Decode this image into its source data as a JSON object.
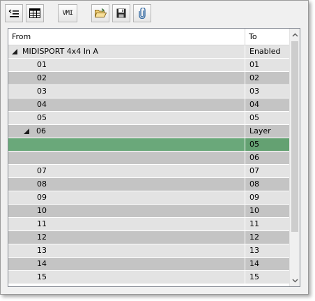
{
  "toolbar": {
    "buttons": [
      {
        "icon": "indent-list-icon"
      },
      {
        "icon": "grid-table-icon"
      },
      {
        "icon": "vmi-icon",
        "label": "VMI"
      },
      {
        "icon": "open-folder-icon"
      },
      {
        "icon": "save-floppy-icon"
      },
      {
        "icon": "paperclip-icon"
      }
    ]
  },
  "table": {
    "columns": {
      "from": "From",
      "to": "To"
    },
    "rows": [
      {
        "from": "MIDISPORT 4x4 In A",
        "to": "Enabled",
        "level": 0,
        "expanded": true,
        "shade": "light"
      },
      {
        "from": "01",
        "to": "01",
        "level": 2,
        "shade": "light"
      },
      {
        "from": "02",
        "to": "02",
        "level": 2,
        "shade": "dark"
      },
      {
        "from": "03",
        "to": "03",
        "level": 2,
        "shade": "light"
      },
      {
        "from": "04",
        "to": "04",
        "level": 2,
        "shade": "dark"
      },
      {
        "from": "05",
        "to": "05",
        "level": 2,
        "shade": "light"
      },
      {
        "from": "06",
        "to": "Layer",
        "level": 1,
        "expanded": true,
        "shade": "dark"
      },
      {
        "from": "",
        "to": "05",
        "level": 2,
        "shade": "selected"
      },
      {
        "from": "",
        "to": "06",
        "level": 2,
        "shade": "dark"
      },
      {
        "from": "07",
        "to": "07",
        "level": 2,
        "shade": "light"
      },
      {
        "from": "08",
        "to": "08",
        "level": 2,
        "shade": "dark"
      },
      {
        "from": "09",
        "to": "09",
        "level": 2,
        "shade": "light"
      },
      {
        "from": "10",
        "to": "10",
        "level": 2,
        "shade": "dark"
      },
      {
        "from": "11",
        "to": "11",
        "level": 2,
        "shade": "light"
      },
      {
        "from": "12",
        "to": "12",
        "level": 2,
        "shade": "dark"
      },
      {
        "from": "13",
        "to": "13",
        "level": 2,
        "shade": "light"
      },
      {
        "from": "14",
        "to": "14",
        "level": 2,
        "shade": "dark"
      },
      {
        "from": "15",
        "to": "15",
        "level": 2,
        "shade": "light"
      }
    ]
  },
  "colors": {
    "row_light": "#e3e3e3",
    "row_dark": "#c4c4c4",
    "row_selected": "#6aa87a"
  }
}
